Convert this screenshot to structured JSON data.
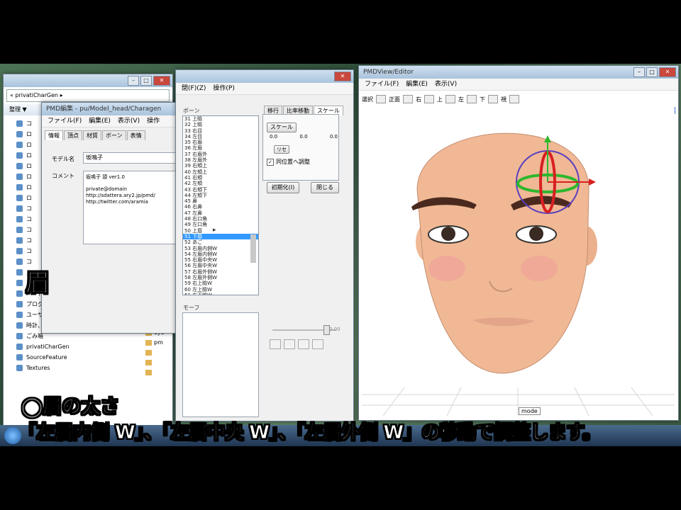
{
  "explorer": {
    "address": "« privatiCharGen ▸",
    "toolbar": "整理 ▼",
    "nav": [
      "コ",
      "ロ",
      "ロ",
      "ロ",
      "ロ",
      "ロ",
      "ロ",
      "ロ",
      "コ",
      "コ",
      "コ",
      "コ",
      "コ",
      "コ",
      "コ",
      "コ",
      "ハードウェアとサウンド",
      "プログラム",
      "ユーザー アカウントと家族のため",
      "時計、言語、および地域",
      "ごみ箱",
      "privatiCharGen",
      "SourceFeature",
      "Textures"
    ],
    "files": [
      "eye",
      "eye",
      "eye",
      "pm",
      "",
      "",
      ""
    ]
  },
  "model_edit": {
    "title": "PMD編集 - pu/Model_head/Charagen",
    "menu": [
      "ファイル(F)",
      "編集(E)",
      "表示(V)",
      "操作"
    ],
    "tabs": [
      "情報",
      "頂点",
      "材質",
      "ボーン",
      "表情"
    ],
    "model_label": "モデル名",
    "model_value": "坂鳴子",
    "comment_label": "コメント",
    "comment_lines": [
      "坂鳴子 頭 ver1.0",
      "",
      "private@domain",
      "http://sdattera.ary2.jp/pmd/",
      "http://twitter.com/aramia"
    ]
  },
  "bone_panel": {
    "menu": [
      "閉(F)(Z)",
      "操作(P)"
    ],
    "bone_header": "ボーン",
    "bones": [
      "31 上瞼",
      "32 上瞼",
      "33 右目",
      "34 左目",
      "35 右眉",
      "36 左眉",
      "37 右眉外",
      "38 左眉外",
      "39 右頬上",
      "40 左頬上",
      "41 右頬",
      "42 左頬",
      "43 右頬下",
      "44 左頬下",
      "45 鼻",
      "46 右鼻",
      "47 左鼻",
      "48 右口角",
      "49 左口角",
      "50 上唇",
      "51 下唇",
      "52 あご",
      "53 右眉内側W",
      "54 左眉内側W",
      "55 右眉中央W",
      "56 左眉中央W",
      "57 右眉外側W",
      "58 左眉外側W",
      "59 右上瞼W",
      "60 左上瞼W",
      "61 右下瞼W",
      "62 左下瞼W"
    ],
    "selected_index": 20,
    "morph_header": "モーフ",
    "tabs": [
      "移行",
      "比率移動",
      "スケール"
    ],
    "scale_btn": "スケール",
    "vals": [
      "0.0",
      "0.0",
      "0.0"
    ],
    "small_btn": "リセ",
    "checkbox_label": "同位置へ調整",
    "init_btn": "初期化(I)",
    "close_btn": "閉じる",
    "morph_weight": "0.00"
  },
  "pmd": {
    "title": "PMDView/Editor",
    "menu": [
      "ファイル(F)",
      "編集(E)",
      "表示(V)"
    ],
    "toolbar": [
      "選択",
      "正面",
      "右",
      "上",
      "左",
      "下",
      "視"
    ],
    "status": "mode"
  },
  "captions": {
    "topic": "眉",
    "heading": "◯眉の太さ",
    "body": "「左眉内側 W」、「左眉中央 W」、「左眉外側 W」の移動で調整します。"
  },
  "colors": {
    "accent": "#3399ff",
    "skin": "#f0b894"
  }
}
